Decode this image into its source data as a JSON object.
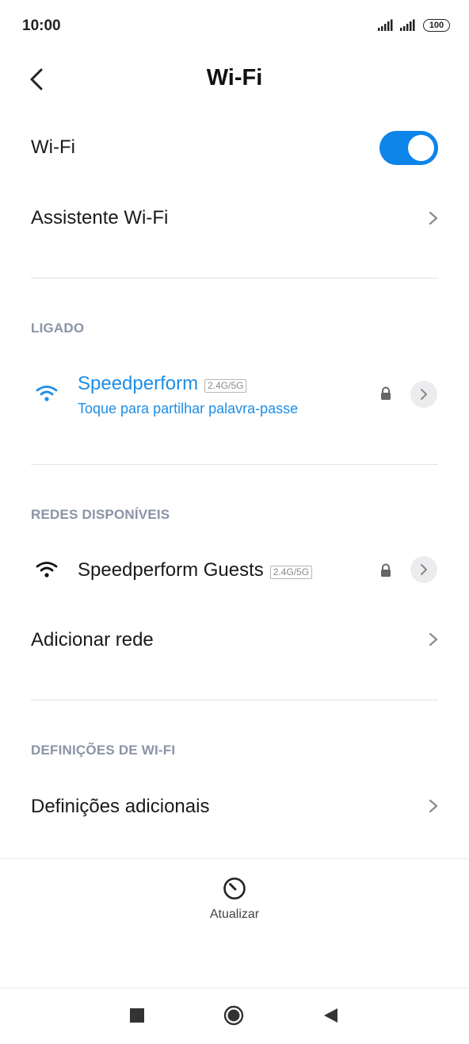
{
  "status_bar": {
    "time": "10:00",
    "battery": "100"
  },
  "header": {
    "title": "Wi-Fi"
  },
  "wifi_toggle": {
    "label": "Wi-Fi",
    "enabled": true
  },
  "assistant": {
    "label": "Assistente Wi-Fi"
  },
  "connected": {
    "section": "LIGADO",
    "network": {
      "name": "Speedperform",
      "band": "2.4G/5G",
      "subtitle": "Toque para partilhar palavra-passe"
    }
  },
  "available": {
    "section": "REDES DISPONÍVEIS",
    "networks": [
      {
        "name": "Speedperform Guests",
        "band": "2.4G/5G"
      }
    ],
    "add_network": "Adicionar rede"
  },
  "settings": {
    "section": "DEFINIÇÕES DE WI-FI",
    "additional": "Definições adicionais"
  },
  "refresh": {
    "label": "Atualizar"
  },
  "colors": {
    "accent": "#0d84e8",
    "link": "#1e8ee6",
    "section": "#8b93a6"
  }
}
